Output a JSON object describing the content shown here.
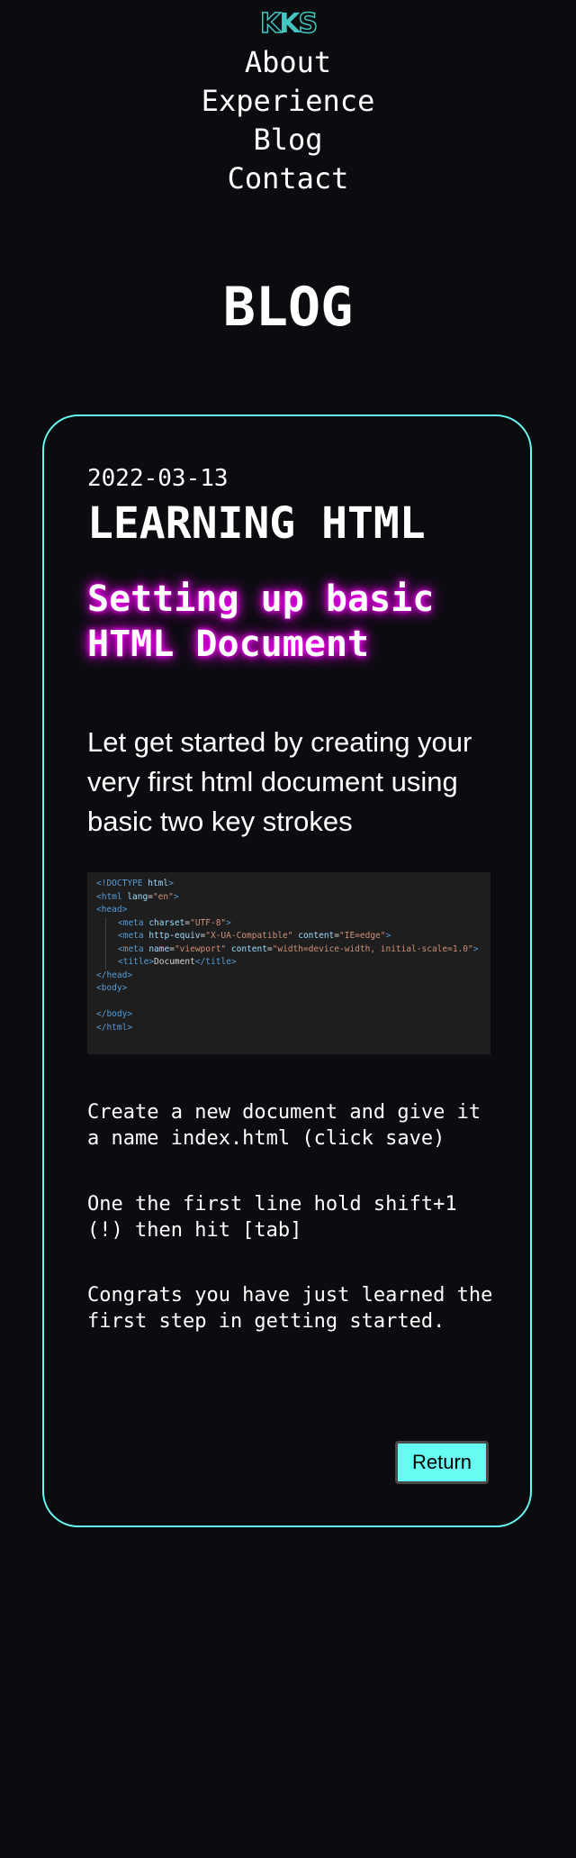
{
  "logo": {
    "k1": "K",
    "k2": "K",
    "s": "S"
  },
  "nav": {
    "items": [
      {
        "label": "About"
      },
      {
        "label": "Experience"
      },
      {
        "label": "Blog"
      },
      {
        "label": "Contact"
      }
    ]
  },
  "page": {
    "title": "BLOG"
  },
  "post": {
    "date": "2022-03-13",
    "title": "LEARNING HTML",
    "subtitle": "Setting up basic HTML Document",
    "intro": "Let get started by creating your very first html document using basic two key strokes",
    "steps": [
      "Create a new document and give it a name index.html (click save)",
      "One the first line hold shift+1 (!) then hit [tab]",
      "Congrats you have just learned the first step in getting started."
    ],
    "return_label": "Return"
  },
  "code": {
    "doctype_open": "<!DOCTYPE",
    "doctype_kw": " html",
    "doctype_close": ">",
    "html_open": "<html",
    "html_attr": " lang",
    "html_eq": "=",
    "html_val": "\"en\"",
    "html_close": ">",
    "head_open": "<head>",
    "meta1_open": "<meta",
    "meta1_attr": " charset",
    "meta1_eq": "=",
    "meta1_val": "\"UTF-8\"",
    "meta1_close": ">",
    "meta2_open": "<meta",
    "meta2_attr1": " http-equiv",
    "meta2_eq1": "=",
    "meta2_val1": "\"X-UA-Compatible\"",
    "meta2_attr2": " content",
    "meta2_eq2": "=",
    "meta2_val2": "\"IE=edge\"",
    "meta2_close": ">",
    "meta3_open": "<meta",
    "meta3_attr1": " name",
    "meta3_eq1": "=",
    "meta3_val1": "\"viewport\"",
    "meta3_attr2": " content",
    "meta3_eq2": "=",
    "meta3_val2": "\"width=device-width, initial-scale=1.0\"",
    "meta3_close": ">",
    "title_open": "<title>",
    "title_text": "Document",
    "title_close": "</title>",
    "head_close": "</head>",
    "body_open": "<body>",
    "body_close": "</body>",
    "html_end": "</html>"
  },
  "colors": {
    "background": "#0b0c10",
    "accent": "#66fcf1",
    "logo": "#45c4c0",
    "neon": "#ff00ff",
    "code_bg": "#1e1e1e"
  }
}
